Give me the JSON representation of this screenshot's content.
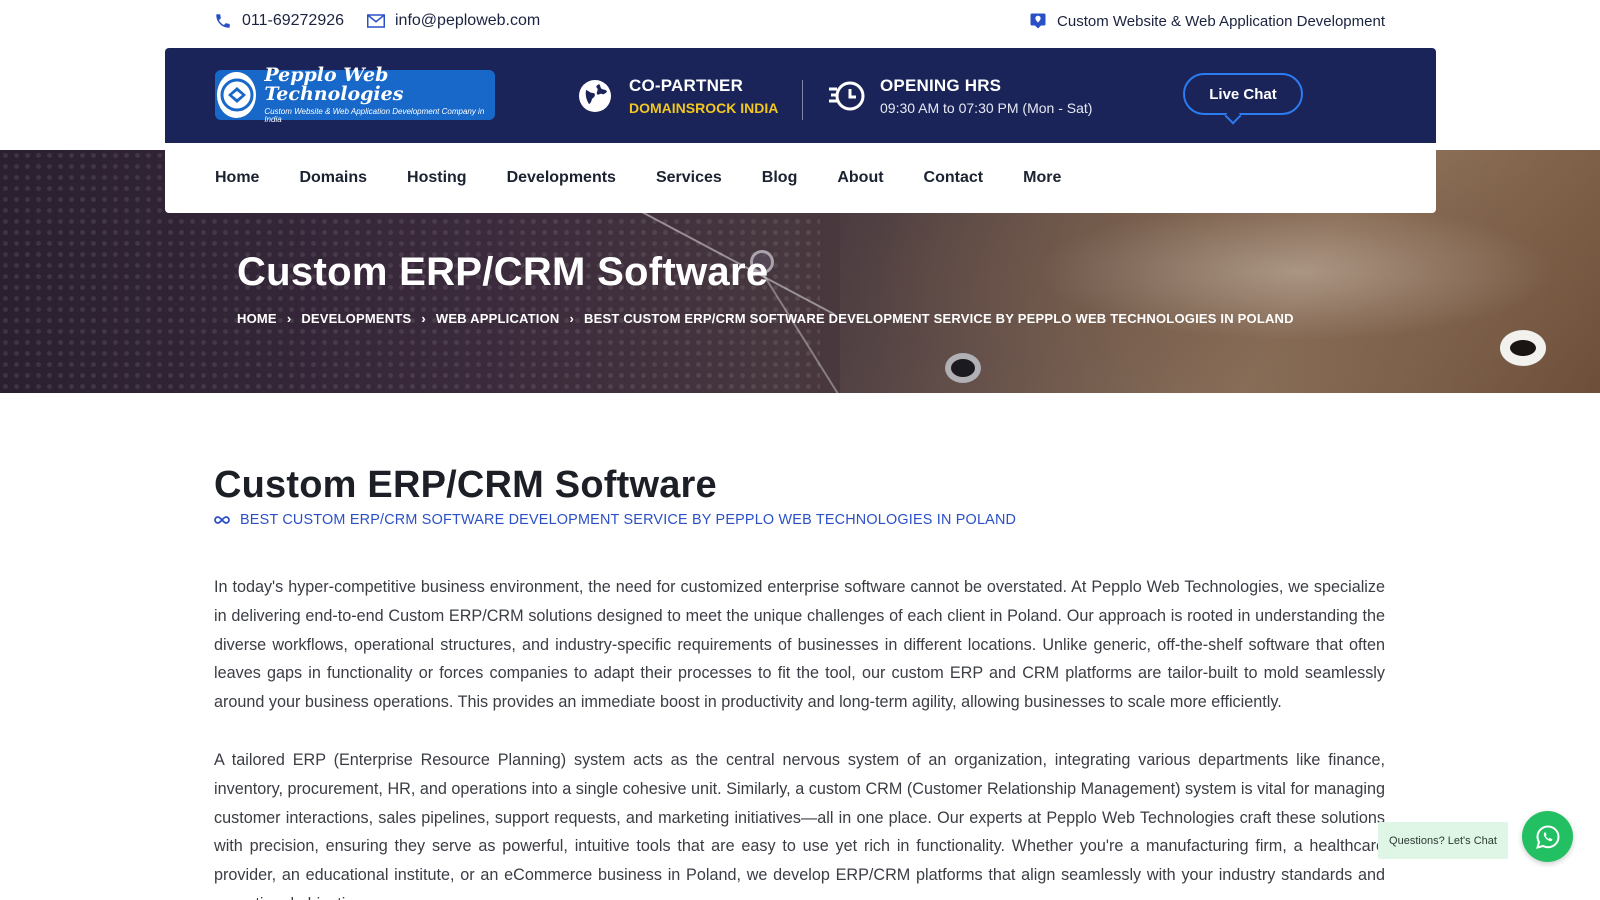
{
  "topbar": {
    "phone": "011-69272926",
    "email": "info@peploweb.com",
    "tagline": "Custom Website & Web Application Development"
  },
  "header": {
    "logo_name": "Pepplo Web Technologies",
    "logo_tagline": "Custom Website & Web Application Development Company in India",
    "copartner_label": "CO-PARTNER",
    "copartner_value": "DOMAINSROCK INDIA",
    "hours_label": "OPENING HRS",
    "hours_value": "09:30 AM to 07:30 PM (Mon - Sat)",
    "live_chat": "Live Chat"
  },
  "nav": {
    "items": [
      {
        "label": "Home"
      },
      {
        "label": "Domains"
      },
      {
        "label": "Hosting"
      },
      {
        "label": "Developments"
      },
      {
        "label": "Services"
      },
      {
        "label": "Blog"
      },
      {
        "label": "About"
      },
      {
        "label": "Contact"
      },
      {
        "label": "More"
      }
    ]
  },
  "hero": {
    "title": "Custom ERP/CRM Software",
    "breadcrumb": [
      {
        "label": "HOME"
      },
      {
        "label": "DEVELOPMENTS"
      },
      {
        "label": "WEB APPLICATION"
      },
      {
        "label": "BEST CUSTOM ERP/CRM SOFTWARE DEVELOPMENT SERVICE BY PEPPLO WEB TECHNOLOGIES IN POLAND"
      }
    ]
  },
  "content": {
    "title": "Custom ERP/CRM Software",
    "subtitle": "BEST CUSTOM ERP/CRM SOFTWARE DEVELOPMENT SERVICE BY PEPPLO WEB TECHNOLOGIES IN POLAND",
    "paragraph1": "In today's hyper-competitive business environment, the need for customized enterprise software cannot be overstated. At Pepplo Web Technologies, we specialize in delivering end-to-end Custom ERP/CRM solutions designed to meet the unique challenges of each client in Poland. Our approach is rooted in understanding the diverse workflows, operational structures, and industry-specific requirements of businesses in different locations. Unlike generic, off-the-shelf software that often leaves gaps in functionality or forces companies to adapt their processes to fit the tool, our custom ERP and CRM platforms are tailor-built to mold seamlessly around your business operations. This provides an immediate boost in productivity and long-term agility, allowing businesses to scale more efficiently.",
    "paragraph2": "A tailored ERP (Enterprise Resource Planning) system acts as the central nervous system of an organization, integrating various departments like finance, inventory, procurement, HR, and operations into a single cohesive unit. Similarly, a custom CRM (Customer Relationship Management) system is vital for managing customer interactions, sales pipelines, support requests, and marketing initiatives—all in one place. Our experts at Pepplo Web Technologies craft these solutions with precision, ensuring they serve as powerful, intuitive tools that are easy to use yet rich in functionality. Whether you're a manufacturing firm, a healthcare provider, an educational institute, or an eCommerce business in Poland, we develop ERP/CRM platforms that align seamlessly with your industry standards and operational objectives."
  },
  "floating": {
    "questions": "Questions? Let's Chat"
  },
  "colors": {
    "navy": "#1a2459",
    "accent_blue": "#2b50c6",
    "yellow": "#f3c620",
    "whatsapp": "#23c063"
  },
  "icons": [
    "phone-icon",
    "email-icon",
    "location-pin-icon",
    "globe-icon",
    "clock-icon",
    "infinity-icon",
    "chevron-right-icon",
    "whatsapp-icon"
  ]
}
